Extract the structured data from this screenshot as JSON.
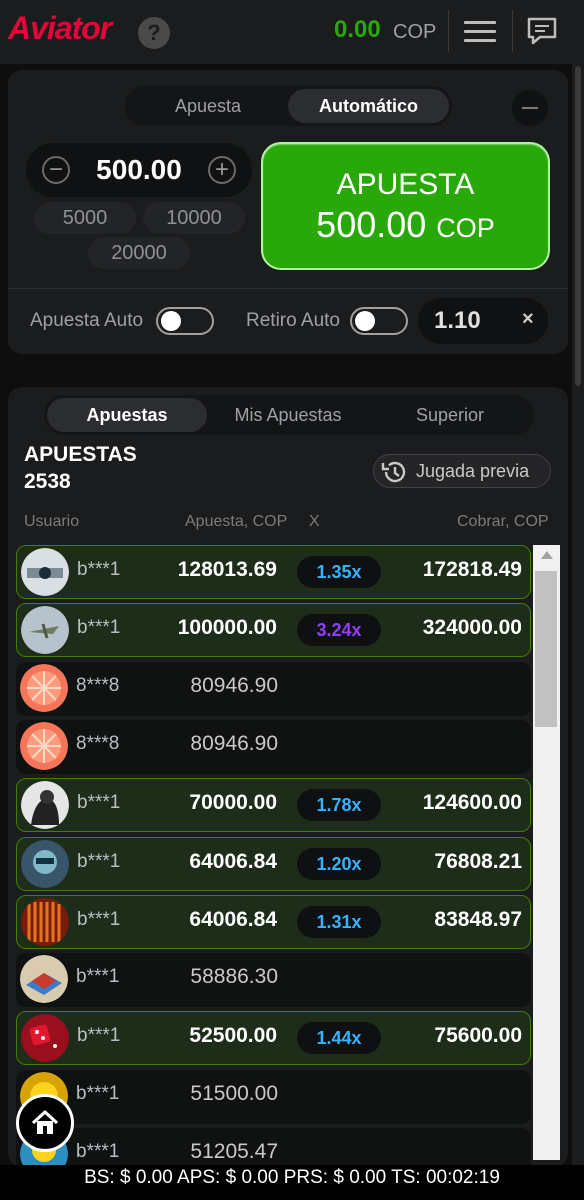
{
  "header": {
    "logo": "Aviator",
    "help_icon": "question-icon",
    "balance": "0.00",
    "currency": "COP",
    "menu_icon": "hamburger-icon",
    "chat_icon": "chat-icon"
  },
  "bet_panel": {
    "tabs": [
      "Apuesta",
      "Automático"
    ],
    "active_tab": "Automático",
    "minimize_icon": "minus-icon",
    "stake": "500.00",
    "quick_amounts": [
      "5000",
      "10000",
      "20000"
    ],
    "bet_button": {
      "label": "APUESTA",
      "amount": "500.00",
      "currency": "COP"
    },
    "auto_bet_label": "Apuesta Auto",
    "auto_cashout_label": "Retiro Auto",
    "auto_bet_on": false,
    "auto_cashout_on": false,
    "cashout_multiplier": "1.10",
    "clear_icon": "close-icon"
  },
  "bets": {
    "tabs": [
      "Apuestas",
      "Mis Apuestas",
      "Superior"
    ],
    "active_tab": "Apuestas",
    "title": "APUESTAS",
    "count": "2538",
    "previous_round_label": "Jugada previa",
    "columns": {
      "user": "Usuario",
      "bet": "Apuesta, COP",
      "mult": "X",
      "cashout": "Cobrar, COP"
    },
    "rows": [
      {
        "user": "b***1",
        "bet": "128013.69",
        "mult": "1.35x",
        "cashout": "172818.49",
        "won": true
      },
      {
        "user": "b***1",
        "bet": "100000.00",
        "mult": "3.24x",
        "cashout": "324000.00",
        "won": true
      },
      {
        "user": "8***8",
        "bet": "80946.90",
        "mult": "",
        "cashout": "",
        "won": false
      },
      {
        "user": "8***8",
        "bet": "80946.90",
        "mult": "",
        "cashout": "",
        "won": false
      },
      {
        "user": "b***1",
        "bet": "70000.00",
        "mult": "1.78x",
        "cashout": "124600.00",
        "won": true
      },
      {
        "user": "b***1",
        "bet": "64006.84",
        "mult": "1.20x",
        "cashout": "76808.21",
        "won": true
      },
      {
        "user": "b***1",
        "bet": "64006.84",
        "mult": "1.31x",
        "cashout": "83848.97",
        "won": true
      },
      {
        "user": "b***1",
        "bet": "58886.30",
        "mult": "",
        "cashout": "",
        "won": false
      },
      {
        "user": "b***1",
        "bet": "52500.00",
        "mult": "1.44x",
        "cashout": "75600.00",
        "won": true
      },
      {
        "user": "b***1",
        "bet": "51500.00",
        "mult": "",
        "cashout": "",
        "won": false
      },
      {
        "user": "b***1",
        "bet": "51205.47",
        "mult": "",
        "cashout": "",
        "won": false
      }
    ]
  },
  "colors": {
    "green": "#28a909",
    "red": "#e50539",
    "mult_blue": "#34b4ff",
    "mult_purple": "#913ef8"
  },
  "home_icon": "home-icon",
  "footer": "BS: $ 0.00 APS: $ 0.00 PRS: $ 0.00 TS: 00:02:19"
}
